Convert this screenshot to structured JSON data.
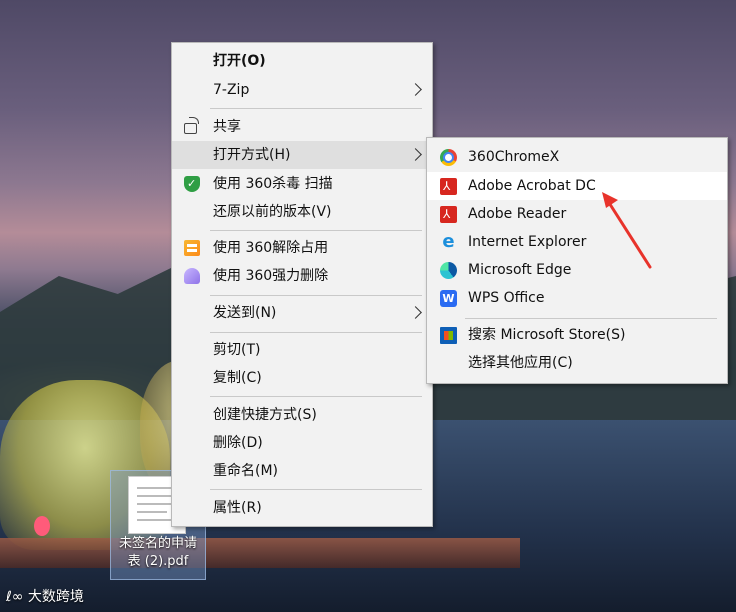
{
  "context_menu": {
    "items": [
      {
        "label": "打开(O)",
        "bold": true
      },
      {
        "label": "7-Zip",
        "submenu": true
      },
      {
        "label": "共享",
        "icon": "share-icon"
      },
      {
        "label": "打开方式(H)",
        "submenu": true,
        "highlighted": true
      },
      {
        "label": "使用 360杀毒 扫描",
        "icon": "shield-icon"
      },
      {
        "label": "还原以前的版本(V)"
      },
      {
        "label": "使用 360解除占用",
        "icon": "unlock-icon"
      },
      {
        "label": "使用 360强力删除",
        "icon": "delete-icon"
      },
      {
        "label": "发送到(N)",
        "submenu": true
      },
      {
        "label": "剪切(T)"
      },
      {
        "label": "复制(C)"
      },
      {
        "label": "创建快捷方式(S)"
      },
      {
        "label": "删除(D)"
      },
      {
        "label": "重命名(M)"
      },
      {
        "label": "属性(R)"
      }
    ]
  },
  "open_with_submenu": {
    "items": [
      {
        "label": "360ChromeX",
        "icon": "chrome-icon"
      },
      {
        "label": "Adobe Acrobat DC",
        "icon": "acrobat-icon",
        "highlighted": true
      },
      {
        "label": "Adobe Reader",
        "icon": "acrobat-icon"
      },
      {
        "label": "Internet Explorer",
        "icon": "ie-icon"
      },
      {
        "label": "Microsoft Edge",
        "icon": "edge-icon"
      },
      {
        "label": "WPS Office",
        "icon": "wps-icon"
      },
      {
        "label": "搜索 Microsoft Store(S)",
        "icon": "store-icon"
      },
      {
        "label": "选择其他应用(C)"
      }
    ]
  },
  "desktop_file": {
    "name": "未签名的申请表 (2).pdf"
  },
  "watermark": "大数跨境",
  "colors": {
    "menu_bg": "#f2f2f2",
    "highlight_bg": "#dfdfdf",
    "annotation_arrow": "#e8332b"
  }
}
